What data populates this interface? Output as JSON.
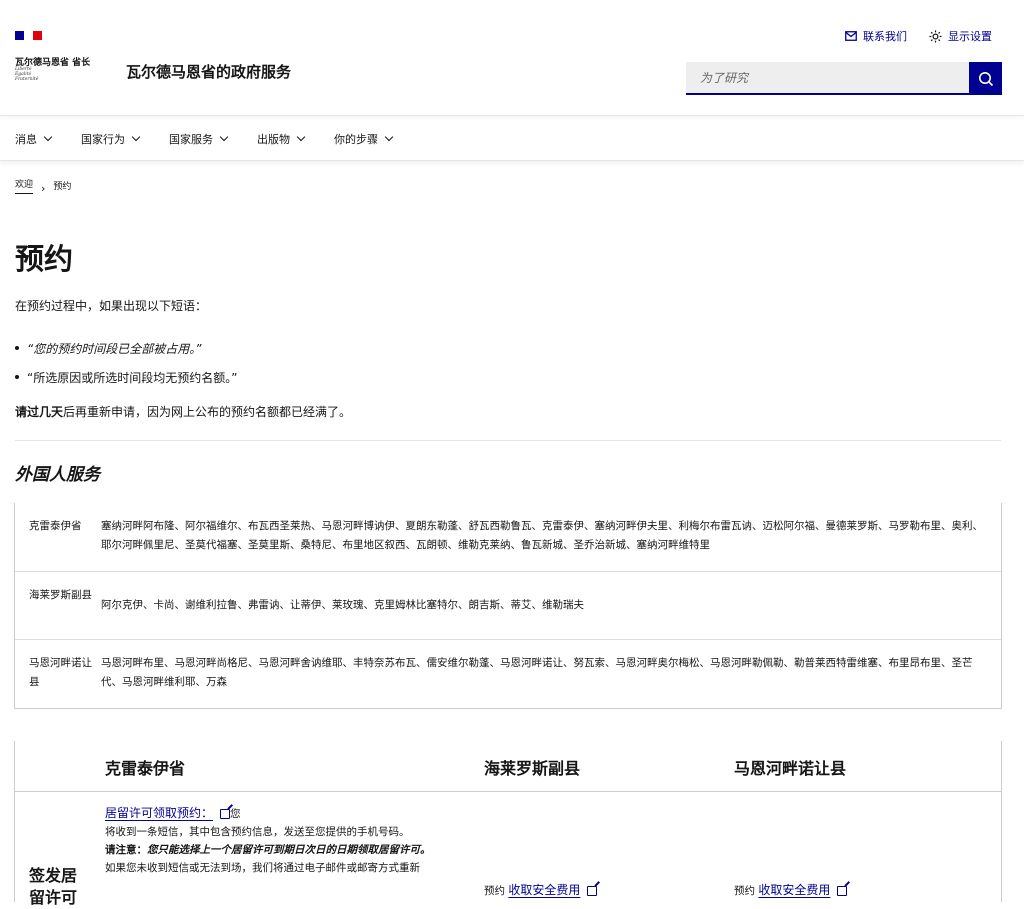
{
  "header": {
    "logo_text": "瓦尔德马恩省 省长",
    "motto": [
      "Liberté",
      "Égalité",
      "Fraternité"
    ],
    "service_title": "瓦尔德马恩省的政府服务",
    "top_links": [
      {
        "label": "联系我们",
        "icon": "mail-icon"
      },
      {
        "label": "显示设置",
        "icon": "sun-icon"
      }
    ],
    "search_placeholder": "为了研究",
    "colors": {
      "primary": "#000091",
      "flag_blue": "#000091",
      "flag_red": "#e1000f"
    }
  },
  "nav": [
    "消息",
    "国家行为",
    "国家服务",
    "出版物",
    "你的步骤"
  ],
  "breadcrumb": {
    "home": "欢迎",
    "current": "预约"
  },
  "main": {
    "title": "预约",
    "intro": "在预约过程中，如果出现以下短语：",
    "bullets": [
      "“您的预约时间段已全部被占用。”",
      "“所选原因或所选时间段均无预约名额。”"
    ],
    "note_bold": "请过几天",
    "note_rest": "后再重新申请，因为网上公布的预约名额都已经满了。",
    "section_title": "外国人服务"
  },
  "departments": [
    {
      "name": "克雷泰伊省",
      "cities": "塞纳河畔阿布隆、阿尔福维尔、布瓦西圣莱热、马恩河畔博讷伊、夏朗东勒蓬、舒瓦西勒鲁瓦、克雷泰伊、塞纳河畔伊夫里、利梅尔布雷瓦讷、迈松阿尔福、曼德莱罗斯、马罗勒布里、奥利、耶尔河畔佩里尼、圣莫代福塞、圣莫里斯、桑特尼、布里地区叙西、瓦朗顿、维勒克莱纳、鲁瓦新城、圣乔治新城、塞纳河畔维特里"
    },
    {
      "name": "海莱罗斯副县",
      "cities": "阿尔克伊、卡尚、谢维利拉鲁、弗雷讷、让蒂伊、莱玫瑰、克里姆林比塞特尔、朗吉斯、蒂艾、维勒瑞夫"
    },
    {
      "name": "马恩河畔诺让县",
      "cities": "马恩河畔布里、马恩河畔尚格尼、马恩河畔舍讷维耶、丰特奈苏布瓦、儒安维尔勒蓬、马恩河畔诺让、努瓦索、马恩河畔奥尔梅松、马恩河畔勒佩勒、勒普莱西特雷维塞、布里昂布里、圣芒代、马恩河畔维利耶、万森"
    }
  ],
  "comparison": {
    "headers": [
      "克雷泰伊省",
      "海莱罗斯副县",
      "马恩河畔诺让县"
    ],
    "row_label": "签发居留许可",
    "cell1": {
      "link": "居留许可领取预约：",
      "after_link": "您",
      "line1": "将收到一条短信，其中包含预约信息，发送至您提供的手机号码。",
      "note_label": "请注意：",
      "note_italic": "您只能选择上一个居留许可到期日次日的日期领取居留许可。",
      "line3": "如果您未收到短信或无法到场，我们将通过电子邮件或邮寄方式重新"
    },
    "cell2": {
      "prefix": "预约",
      "link": "收取安全费用"
    },
    "cell3": {
      "prefix": "预约",
      "link": "收取安全费用"
    }
  }
}
